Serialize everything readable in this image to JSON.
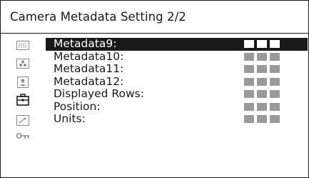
{
  "title": "Camera Metadata Setting 2/2",
  "sidebar": {
    "icons": [
      {
        "name": "dot-grid-icon",
        "active": false
      },
      {
        "name": "shading-icon",
        "active": false
      },
      {
        "name": "person-icon",
        "active": false
      },
      {
        "name": "toolbox-icon",
        "active": true
      },
      {
        "name": "arrow-icon",
        "active": false
      },
      {
        "name": "key-icon",
        "active": false
      }
    ]
  },
  "menu": {
    "rows": [
      {
        "label": "Metadata9:",
        "selected": true,
        "value_blocks": 3
      },
      {
        "label": "Metadata10:",
        "selected": false,
        "value_blocks": 3
      },
      {
        "label": "Metadata11:",
        "selected": false,
        "value_blocks": 3
      },
      {
        "label": "Metadata12:",
        "selected": false,
        "value_blocks": 3
      },
      {
        "label": "Displayed Rows:",
        "selected": false,
        "value_blocks": 3
      },
      {
        "label": "Position:",
        "selected": false,
        "value_blocks": 3
      },
      {
        "label": "Units:",
        "selected": false,
        "value_blocks": 3
      }
    ]
  },
  "colors": {
    "ink": "#1a1a1a",
    "inactive_icon": "#8a8a8a",
    "value_block": "#9a9a9a",
    "selected_background": "#1a1a1a",
    "selected_text": "#ffffff"
  }
}
